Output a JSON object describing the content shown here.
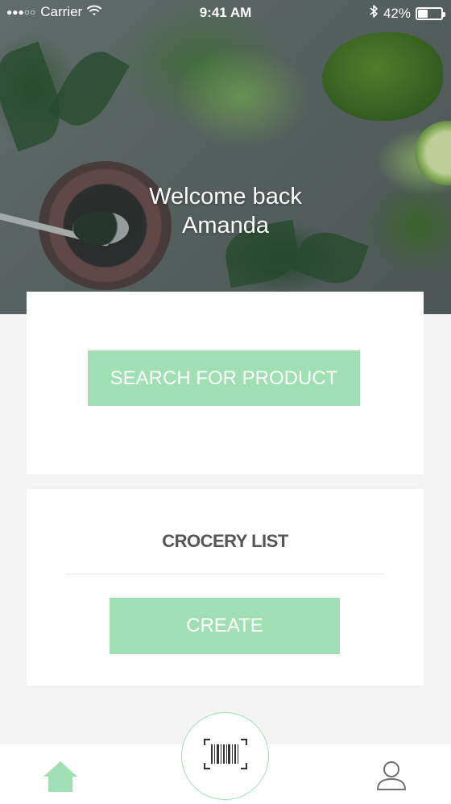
{
  "status_bar": {
    "signal": "●●●○○",
    "carrier": "Carrier",
    "time": "9:41 AM",
    "battery_percent": "42%",
    "battery_level": 0.42,
    "icons": [
      "wifi-icon",
      "bluetooth-icon",
      "battery-icon"
    ]
  },
  "hero": {
    "welcome_line1": "Welcome back",
    "welcome_line2": "Amanda"
  },
  "search_card": {
    "button_label": "SEARCH FOR PRODUCT"
  },
  "grocery_card": {
    "title": "CROCERY LIST",
    "button_label": "CREATE"
  },
  "tab_bar": {
    "items": [
      {
        "name": "home",
        "icon": "home-icon",
        "active": true
      },
      {
        "name": "scan",
        "icon": "barcode-icon"
      },
      {
        "name": "profile",
        "icon": "user-icon"
      }
    ]
  },
  "colors": {
    "accent": "#a0dfb4",
    "background": "#f3f3f3",
    "card": "#ffffff",
    "title_text": "#555555",
    "inactive_icon": "#6f6f6f"
  }
}
